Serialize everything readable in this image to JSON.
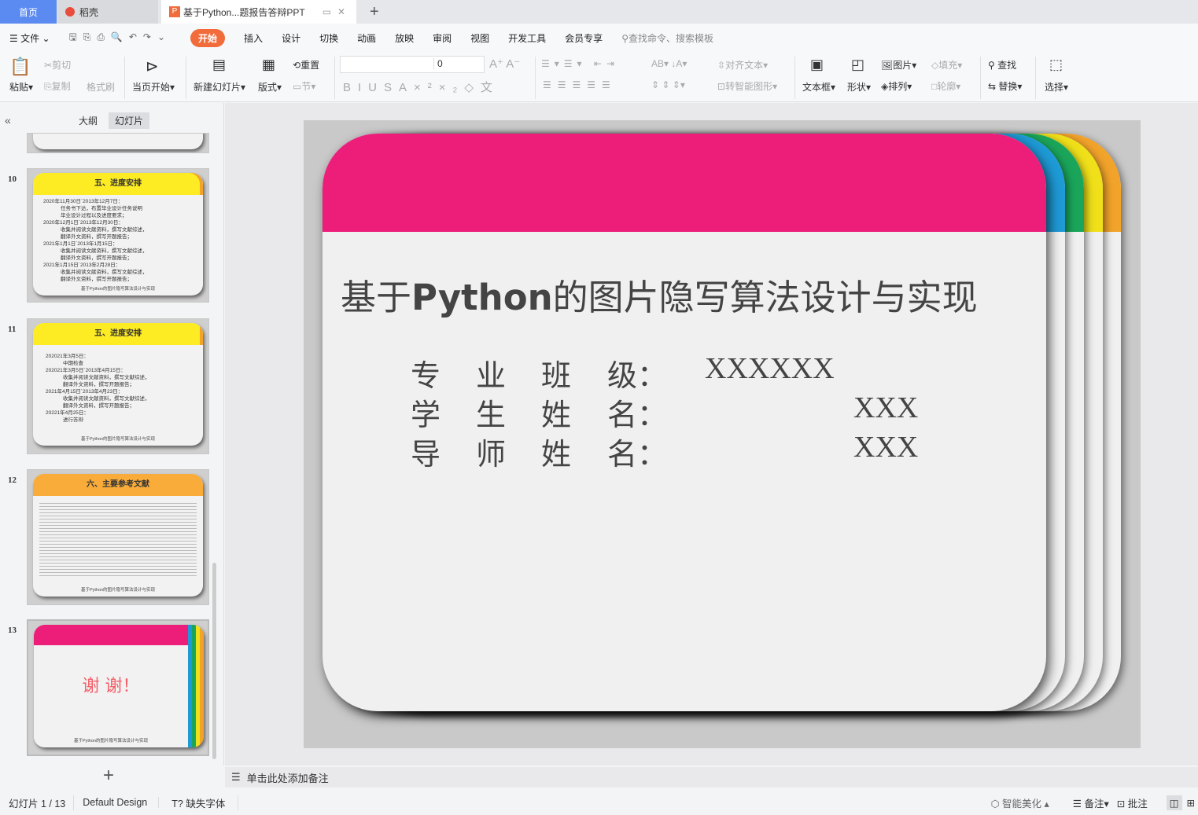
{
  "tabs": [
    {
      "label": "首页"
    },
    {
      "label": "稻壳"
    },
    {
      "label": "基于Python...题报告答辩PPT"
    }
  ],
  "menu": {
    "file": "文件",
    "items": [
      "开始",
      "插入",
      "设计",
      "切换",
      "动画",
      "放映",
      "审阅",
      "视图",
      "开发工具",
      "会员专享"
    ],
    "search": "查找命令、搜索模板"
  },
  "ribbon": {
    "paste": "粘贴",
    "cut": "剪切",
    "copy": "复制",
    "format_painter": "格式刷",
    "play_from_current": "当页开始",
    "new_slide": "新建幻灯片",
    "layout": "版式",
    "reset": "重置",
    "section": "节",
    "font_size": "0",
    "align_text": "对齐文本",
    "smartart": "转智能图形",
    "textbox": "文本框",
    "shape": "形状",
    "picture": "图片",
    "arrange": "排列",
    "fill": "填充",
    "outline": "轮廓",
    "find": "查找",
    "replace": "替换",
    "select": "选择"
  },
  "panel": {
    "tab_outline": "大纲",
    "tab_slides": "幻灯片",
    "add": "+"
  },
  "thumbnails": [
    {
      "num": "10",
      "title": "五、进度安排",
      "lines": [
        "2020年11月30日`2013年12月7日：",
        "任务书下达，布置毕业设计任务说明",
        "毕业设计过程以及进度要求；",
        "2020年12月1日`2013年12月30日：",
        "收集并阅读文献资料，撰写文献综述，",
        "翻译外文资料，撰写开题报告；",
        "2021年1月1日`2013年1月15日：",
        "收集并阅读文献资料，撰写文献综述，",
        "翻译外文资料，撰写开题报告；",
        "2021年1月15日`2013年2月28日：",
        "收集并阅读文献资料，撰写文献综述，",
        "翻译外文资料，撰写开题报告；"
      ],
      "footer": "基于Python的图片隐写算法设计与实现"
    },
    {
      "num": "11",
      "title": "五、进度安排",
      "lines": [
        "202021年3月5日：",
        "中期检查",
        "202021年3月5日`2013年4月15日：",
        "收集并阅读文献资料，撰写文献综述，",
        "翻译外文资料，撰写开题报告；",
        "2021年4月15日`2013年4月23日：",
        "收集并阅读文献资料，撰写文献综述，",
        "翻译外文资料，撰写开题报告；",
        "20221年4月25日：",
        "进行答辩"
      ],
      "footer": "基于Python的图片隐写算法设计与实现"
    },
    {
      "num": "12",
      "title": "六、主要参考文献",
      "footer": "基于Python的图片隐写算法设计与实现"
    },
    {
      "num": "13",
      "title": "谢  谢！",
      "footer": "基于Python的图片隐写算法设计与实现"
    }
  ],
  "slide": {
    "title_pre": "基于",
    "title_bold": "Python",
    "title_post": "的图片隐写算法设计与实现",
    "fields": [
      {
        "label": [
          "专",
          "业",
          "班",
          "级："
        ],
        "value": "XXXXXX"
      },
      {
        "label": [
          "学",
          "生",
          "姓",
          "名："
        ],
        "value": "XXX"
      },
      {
        "label": [
          "导",
          "师",
          "姓",
          "名："
        ],
        "value": "XXX"
      }
    ]
  },
  "notes": "单击此处添加备注",
  "status": {
    "slide": "幻灯片 1 / 13",
    "design": "Default Design",
    "missing_font": "缺失字体",
    "beautify": "智能美化",
    "notes": "备注",
    "comment": "批注"
  },
  "colors": {
    "pink": "#ec1e7a",
    "blue": "#1e9ad6",
    "green": "#1aa55a",
    "yellow": "#f0e01a",
    "orange": "#f2a32a",
    "accent": "#f26b3a"
  }
}
